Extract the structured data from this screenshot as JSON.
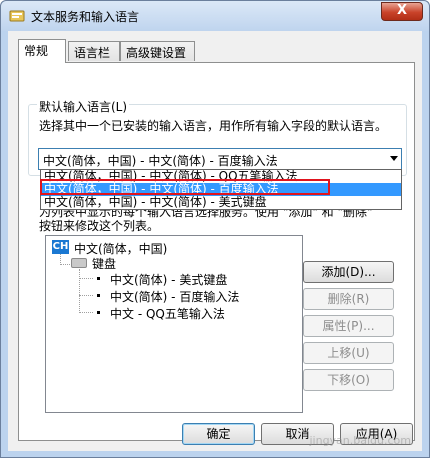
{
  "window": {
    "title": "文本服务和输入语言",
    "close_label": "X"
  },
  "tabs": [
    {
      "label": "常规",
      "active": true
    },
    {
      "label": "语言栏",
      "active": false
    },
    {
      "label": "高级键设置",
      "active": false
    }
  ],
  "default_language": {
    "group_label": "默认输入语言(L)",
    "description": "选择其中一个已安装的输入语言，用作所有输入字段的默认语言。",
    "selected": "中文(简体，中国) - 中文(简体) - 百度输入法",
    "options": [
      "中文(简体，中国) - 中文(简体) - QQ五笔输入法",
      "中文(简体，中国) - 中文(简体) - 百度输入法",
      "中文(简体，中国) - 中文(简体) - 美式键盘"
    ],
    "highlighted_index": 1
  },
  "installed_services": {
    "desc_line1_visible": "为列表中显示的每个输入语言选择服务。使用 \"添加\" 和 \"删除\"",
    "desc_line2": "按钮来修改这个列表。",
    "tree": {
      "language": "中文(简体，中国)",
      "language_icon": "CH",
      "category": "键盘",
      "items": [
        "中文(简体) - 美式键盘",
        "中文(简体) - 百度输入法",
        "中文 - QQ五笔输入法"
      ]
    }
  },
  "side_buttons": {
    "add": "添加(D)...",
    "remove": "删除(R)",
    "properties": "属性(P)...",
    "move_up": "上移(U)",
    "move_down": "下移(O)"
  },
  "footer_buttons": {
    "ok": "确定",
    "cancel": "取消",
    "apply": "应用(A)"
  },
  "watermark": "jingyan.baidu.com",
  "colors": {
    "selection": "#3399ff",
    "annotation_box": "#e0141e",
    "close_button": "#c9432a"
  }
}
